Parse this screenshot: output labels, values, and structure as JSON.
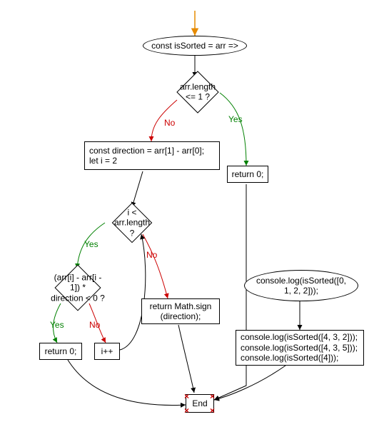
{
  "nodes": {
    "start_def": "const isSorted = arr =>",
    "cond_length": "arr.length <= 1 ?",
    "return_zero_top": "return 0;",
    "assign_direction": "const direction = arr[1] - arr[0];\nlet i = 2",
    "cond_loop": "i < arr.length ?",
    "cond_direction_line1": "(arr[i] - arr[i - 1]) *",
    "cond_direction_line2": "direction < 0 ?",
    "return_zero": "return 0;",
    "inc_i": "i++",
    "return_sign": "return Math.sign\n(direction);",
    "call_first": "console.log(isSorted([0,\n1, 2, 2]));",
    "call_block": "console.log(isSorted([4, 3, 2]));\nconsole.log(isSorted([4, 3, 5]));\nconsole.log(isSorted([4]));",
    "end": "End"
  },
  "edge_labels": {
    "yes": "Yes",
    "no": "No"
  },
  "colors": {
    "yes": "#008000",
    "no": "#cc0000",
    "line": "#000000"
  },
  "chart_data": {
    "type": "flowchart",
    "nodes": [
      {
        "id": "start-entry",
        "kind": "entry"
      },
      {
        "id": "start-def",
        "kind": "terminator",
        "text": "const isSorted = arr =>"
      },
      {
        "id": "cond-length",
        "kind": "decision",
        "text": "arr.length <= 1 ?"
      },
      {
        "id": "return-zero-top",
        "kind": "process",
        "text": "return 0;"
      },
      {
        "id": "assign-direction",
        "kind": "process",
        "text": "const direction = arr[1] - arr[0]; let i = 2"
      },
      {
        "id": "cond-loop",
        "kind": "decision",
        "text": "i < arr.length ?"
      },
      {
        "id": "cond-direction",
        "kind": "decision",
        "text": "(arr[i] - arr[i - 1]) * direction < 0 ?"
      },
      {
        "id": "return-zero",
        "kind": "process",
        "text": "return 0;"
      },
      {
        "id": "inc-i",
        "kind": "process",
        "text": "i++"
      },
      {
        "id": "return-sign",
        "kind": "process",
        "text": "return Math.sign(direction);"
      },
      {
        "id": "call-first",
        "kind": "terminator",
        "text": "console.log(isSorted([0, 1, 2, 2]));"
      },
      {
        "id": "call-block",
        "kind": "process",
        "text": "console.log(isSorted([4, 3, 2])); console.log(isSorted([4, 3, 5])); console.log(isSorted([4]));"
      },
      {
        "id": "end",
        "kind": "end",
        "text": "End"
      }
    ],
    "edges": [
      {
        "from": "start-entry",
        "to": "start-def"
      },
      {
        "from": "start-def",
        "to": "cond-length"
      },
      {
        "from": "cond-length",
        "to": "return-zero-top",
        "label": "Yes"
      },
      {
        "from": "cond-length",
        "to": "assign-direction",
        "label": "No"
      },
      {
        "from": "return-zero-top",
        "to": "end"
      },
      {
        "from": "assign-direction",
        "to": "cond-loop"
      },
      {
        "from": "cond-loop",
        "to": "cond-direction",
        "label": "Yes"
      },
      {
        "from": "cond-loop",
        "to": "return-sign",
        "label": "No"
      },
      {
        "from": "cond-direction",
        "to": "return-zero",
        "label": "Yes"
      },
      {
        "from": "cond-direction",
        "to": "inc-i",
        "label": "No"
      },
      {
        "from": "inc-i",
        "to": "cond-loop"
      },
      {
        "from": "return-zero",
        "to": "end"
      },
      {
        "from": "return-sign",
        "to": "end"
      },
      {
        "from": "call-first",
        "to": "call-block"
      },
      {
        "from": "call-block",
        "to": "end"
      }
    ]
  }
}
